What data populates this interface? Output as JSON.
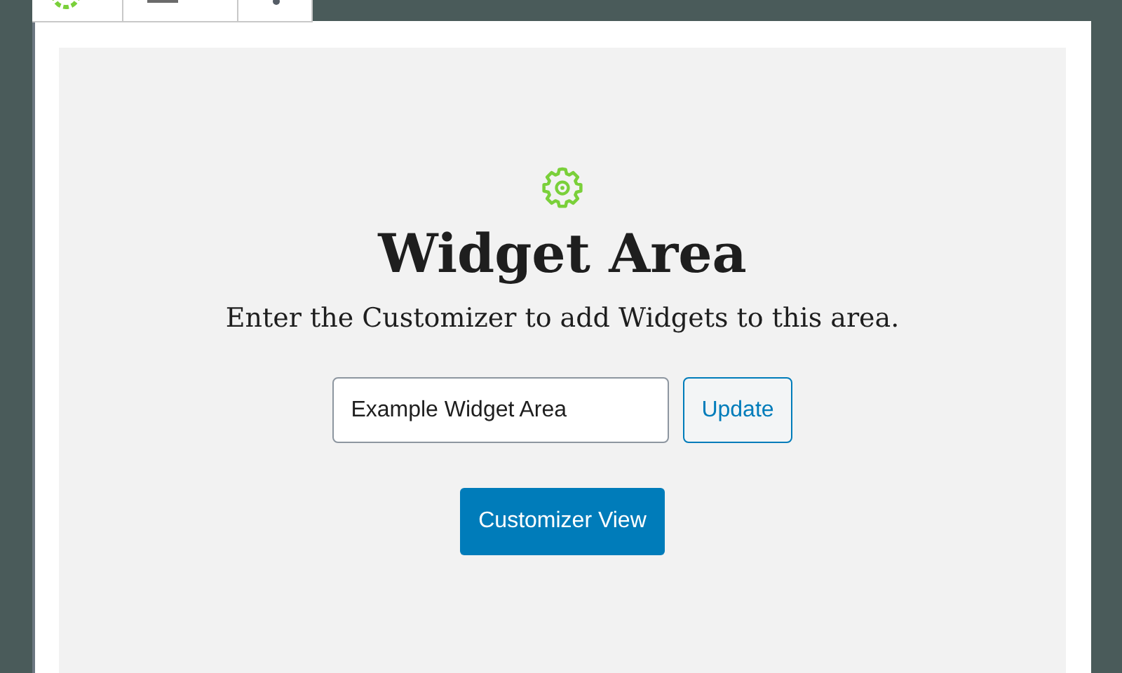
{
  "widget": {
    "title": "Widget Area",
    "description": "Enter the Customizer to add Widgets to this area.",
    "area_field": {
      "value": "Example Widget Area"
    },
    "update_button": "Update",
    "customizer_button": "Customizer View"
  }
}
